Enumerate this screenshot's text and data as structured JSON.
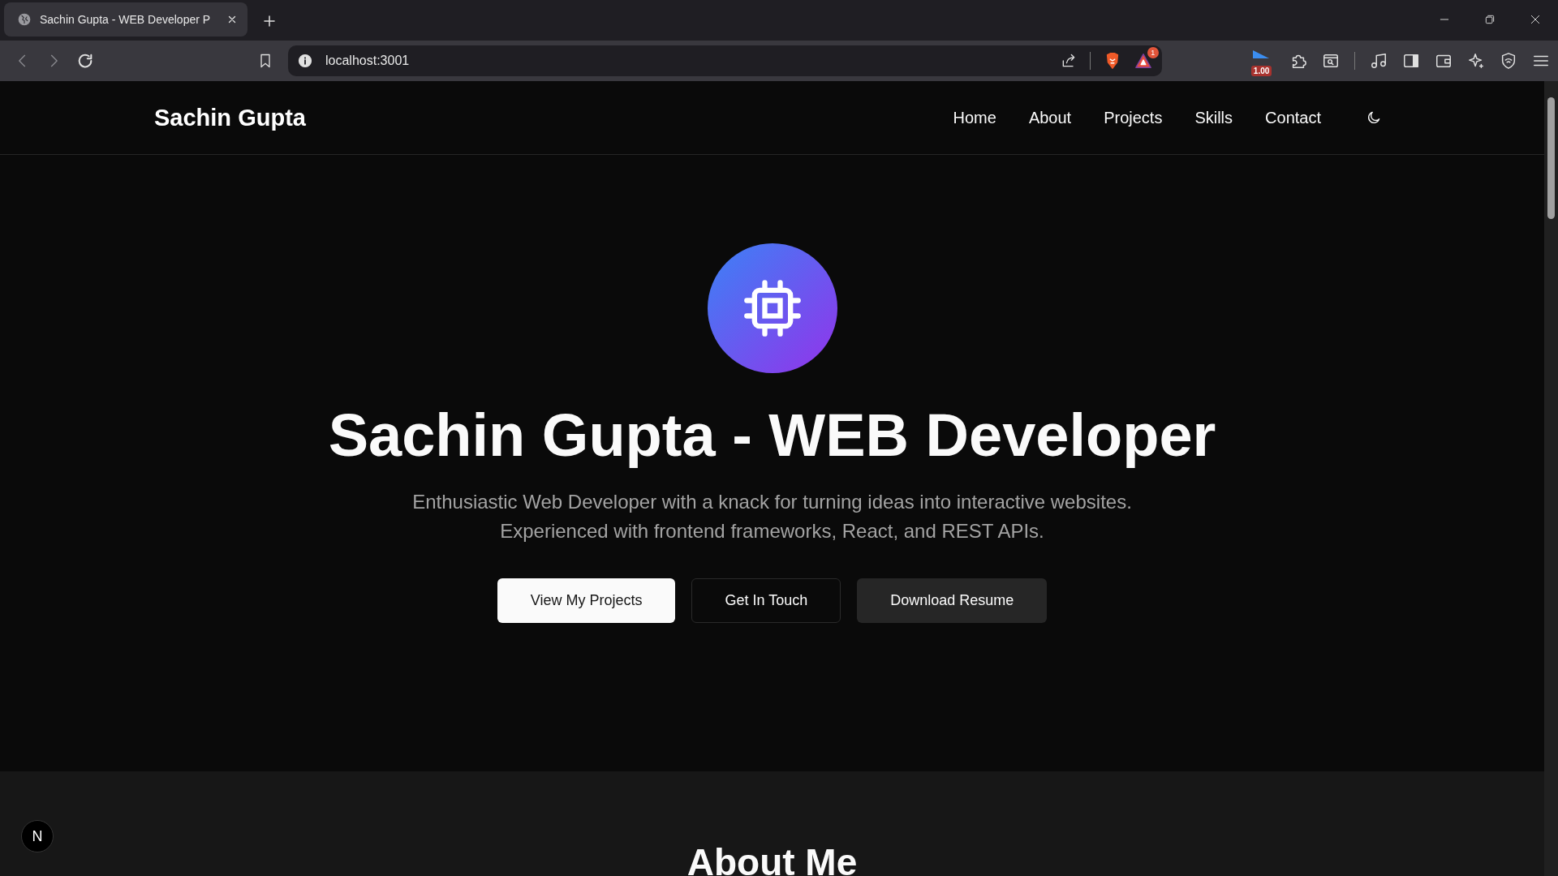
{
  "browser": {
    "tab_title": "Sachin Gupta - WEB Developer P",
    "address": "localhost:3001",
    "rewards_badge": "1",
    "speed_badge": "1.00"
  },
  "site": {
    "brand": "Sachin Gupta",
    "nav": [
      {
        "label": "Home"
      },
      {
        "label": "About"
      },
      {
        "label": "Projects"
      },
      {
        "label": "Skills"
      },
      {
        "label": "Contact"
      }
    ],
    "hero": {
      "title": "Sachin Gupta - WEB Developer",
      "subtitle": "Enthusiastic Web Developer with a knack for turning ideas into interactive websites. Experienced with frontend frameworks, React, and REST APIs.",
      "buttons": [
        {
          "label": "View My Projects",
          "kind": "primary"
        },
        {
          "label": "Get In Touch",
          "kind": "outline"
        },
        {
          "label": "Download Resume",
          "kind": "secondary"
        }
      ]
    },
    "about": {
      "heading": "About Me"
    },
    "dev_badge": "N"
  }
}
